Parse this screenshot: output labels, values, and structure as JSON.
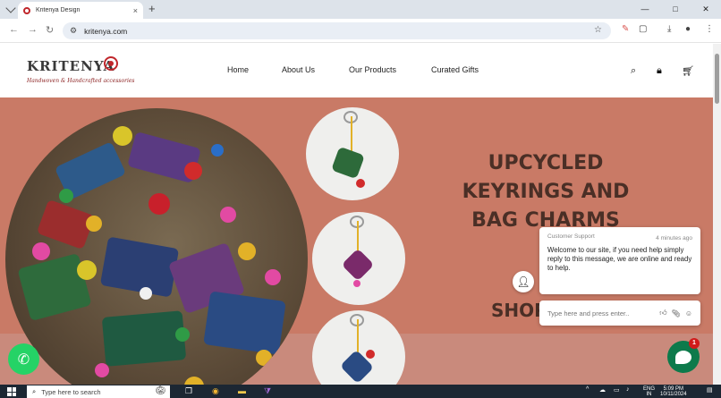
{
  "browser": {
    "tab_title": "Kritenya Design",
    "url": "kritenya.com",
    "new_tab": "+",
    "tab_close": "×",
    "window_controls": [
      "—",
      "□",
      "✕"
    ]
  },
  "site": {
    "logo_text": "KRITENYA",
    "logo_tagline": "Handwoven & Handcrafted accessories",
    "nav": [
      "Home",
      "About Us",
      "Our Products",
      "Curated Gifts"
    ],
    "icons": [
      "search-icon",
      "lock-icon",
      "cart-icon"
    ]
  },
  "hero": {
    "headline_lines": [
      "UPCYCLED",
      "KEYRINGS AND",
      "BAG CHARMS"
    ],
    "cta": "SHOP"
  },
  "chat": {
    "agent_name": "Customer Support",
    "time_ago": "4 minutes ago",
    "message": "Welcome to our site, if you need help simply reply to this message, we are online and ready to help.",
    "input_placeholder": "Type here and press enter..",
    "badge_count": "1"
  },
  "taskbar": {
    "search_placeholder": "Type here to search",
    "lang_top": "ENG",
    "lang_bottom": "IN",
    "time": "5:09 PM",
    "date": "10/11/2024"
  },
  "colors": {
    "hero_bg": "#c97a66",
    "headline": "#4a2f26",
    "brand_red": "#c0262b",
    "whatsapp": "#25d366",
    "chat_green": "#0d7a4b"
  }
}
